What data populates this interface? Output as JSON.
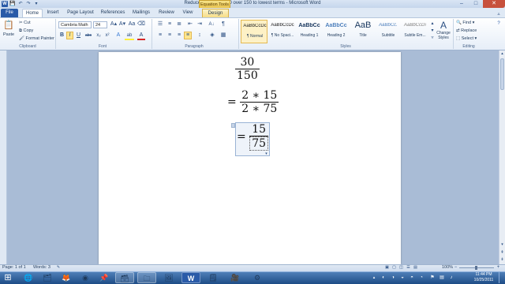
{
  "window": {
    "title": "Reduce the fraction 30 over 150 to lowest terms - Microsoft Word",
    "context_tab_title": "Equation Tools",
    "quick_access": {
      "word_icon": "W",
      "save_icon": "💾",
      "undo_icon": "↶",
      "redo_icon": "↷",
      "customize_icon": "▾"
    },
    "controls": {
      "minimize": "–",
      "maximize": "□",
      "close": "✕"
    }
  },
  "tabs": [
    {
      "label": "File"
    },
    {
      "label": "Home"
    },
    {
      "label": "Insert"
    },
    {
      "label": "Page Layout"
    },
    {
      "label": "References"
    },
    {
      "label": "Mailings"
    },
    {
      "label": "Review"
    },
    {
      "label": "View"
    },
    {
      "label": "Design"
    }
  ],
  "ribbon": {
    "clipboard": {
      "paste": "Paste",
      "cut": "Cut",
      "copy": "Copy",
      "format_painter": "Format Painter",
      "group_label": "Clipboard"
    },
    "font": {
      "font_name": "Cambria Math",
      "font_size": "24",
      "grow_icon": "A▴",
      "shrink_icon": "A▾",
      "change_case_icon": "Aa",
      "clear_format_icon": "⌫",
      "bold": "B",
      "italic": "I",
      "underline": "U",
      "strike": "abc",
      "subscript": "x₂",
      "superscript": "x²",
      "text_effects_icon": "A",
      "highlight_icon": "ab",
      "font_color_icon": "A",
      "group_label": "Font"
    },
    "paragraph": {
      "bullets_icon": "☰",
      "numbering_icon": "≡",
      "multilevel_icon": "≣",
      "decrease_indent_icon": "⇤",
      "increase_indent_icon": "⇥",
      "sort_icon": "A↓",
      "show_marks_icon": "¶",
      "align_left_icon": "≡",
      "center_icon": "≡",
      "align_right_icon": "≡",
      "justify_icon": "≡",
      "line_spacing_icon": "↕",
      "shading_icon": "◈",
      "borders_icon": "▦",
      "group_label": "Paragraph"
    },
    "styles": {
      "items": [
        {
          "preview": "AaBbCcDc",
          "name": "¶ Normal"
        },
        {
          "preview": "AaBbCcDc",
          "name": "¶ No Spaci..."
        },
        {
          "preview": "AaBbCc",
          "name": "Heading 1"
        },
        {
          "preview": "AaBbCc",
          "name": "Heading 2"
        },
        {
          "preview": "AaB",
          "name": "Title"
        },
        {
          "preview": "AaBbCc.",
          "name": "Subtitle"
        },
        {
          "preview": "AaBbCcDı",
          "name": "Subtle Em..."
        }
      ],
      "change_styles": "Change Styles",
      "change_styles_icon": "A",
      "group_label": "Styles"
    },
    "editing": {
      "find": "Find",
      "replace": "Replace",
      "select": "Select",
      "group_label": "Editing"
    }
  },
  "document": {
    "line1": {
      "num": "30",
      "den": "150"
    },
    "line2": {
      "eq": "=",
      "num": "2 ∗ 15",
      "den": "2 ∗ 75"
    },
    "line3": {
      "eq": "=",
      "num": "15",
      "den": "75"
    }
  },
  "status": {
    "page": "Page: 1 of 1",
    "words": "Words: 3",
    "zoom": "100%",
    "zoom_minus": "−",
    "zoom_plus": "+"
  },
  "taskbar": {
    "start_icon": "⊞",
    "apps": [
      {
        "icon": "🌐"
      },
      {
        "icon": "🗂"
      },
      {
        "icon": "🦊"
      },
      {
        "icon": "◉"
      },
      {
        "icon": "📌"
      },
      {
        "icon": "🗃"
      },
      {
        "icon": "🗀"
      },
      {
        "icon": "🖼"
      },
      {
        "icon": "W"
      },
      {
        "icon": "🗒"
      },
      {
        "icon": "🎥"
      },
      {
        "icon": "⚙"
      }
    ],
    "time": "11:44 PM",
    "date": "10/25/2011"
  }
}
